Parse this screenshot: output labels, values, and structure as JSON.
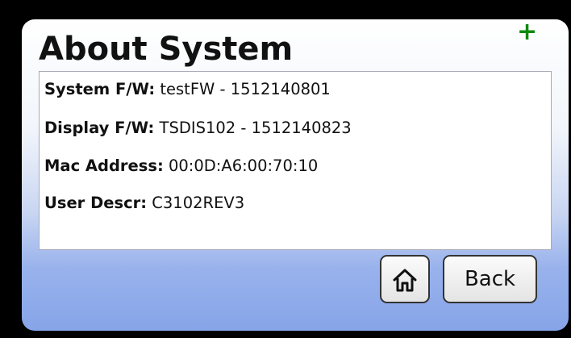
{
  "screen": {
    "title": "About System",
    "add_icon": "+"
  },
  "info": [
    {
      "label": "System F/W:",
      "value": "testFW - 1512140801"
    },
    {
      "label": "Display F/W:",
      "value": "TSDIS102 - 1512140823"
    },
    {
      "label": "Mac Address:",
      "value": "00:0D:A6:00:70:10"
    },
    {
      "label": "User Descr:",
      "value": "C3102REV3"
    }
  ],
  "buttons": {
    "home_icon": "home-icon",
    "back_label": "Back"
  },
  "colors": {
    "accent_plus": "#0a8a0a",
    "gradient_bottom": "#86a4e8"
  }
}
